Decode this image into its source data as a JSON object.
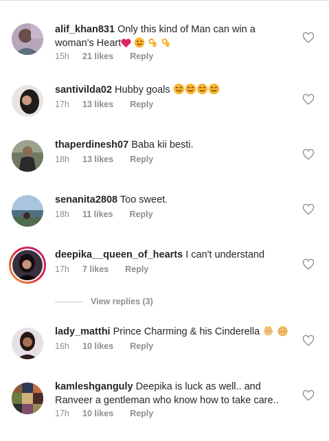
{
  "comments": [
    {
      "username": "alif_khan831",
      "text": "Only this kind of Man can win a woman's Heart",
      "emoji": [
        "heart",
        "smile",
        "ok",
        "ok"
      ],
      "time": "15h",
      "likes": "21 likes",
      "reply": "Reply"
    },
    {
      "username": "santivilda02",
      "text": "Hubby goals",
      "emoji": [
        "smile",
        "smile",
        "smile",
        "smile"
      ],
      "time": "17h",
      "likes": "13 likes",
      "reply": "Reply"
    },
    {
      "username": "thaperdinesh07",
      "text": "Baba kii besti.",
      "emoji": [],
      "time": "18h",
      "likes": "13 likes",
      "reply": "Reply"
    },
    {
      "username": "senanita2808",
      "text": "Too sweet.",
      "emoji": [],
      "time": "18h",
      "likes": "11 likes",
      "reply": "Reply"
    },
    {
      "username": "deepika__queen_of_hearts",
      "text": "I can't understand",
      "emoji": [],
      "time": "17h",
      "likes": "7 likes",
      "reply": "Reply"
    },
    {
      "username": "lady_matthi",
      "text": "Prince Charming & his Cinderella",
      "emoji": [
        "prince",
        "princess"
      ],
      "time": "16h",
      "likes": "10 likes",
      "reply": "Reply"
    },
    {
      "username": "kamleshganguly",
      "text": "Deepika is luck as well.. and Ranveer  a gentleman who know how to take care..",
      "emoji": [],
      "time": "17h",
      "likes": "10 likes",
      "reply": "Reply"
    }
  ],
  "view_replies": "View replies (3)",
  "colors": {
    "text": "#262626",
    "meta": "#8e8e8e",
    "divider": "#c7c7c7",
    "story_ring": "#dc2743",
    "heart_emoji": "#e0245e",
    "smile_emoji": "#f7b733"
  }
}
